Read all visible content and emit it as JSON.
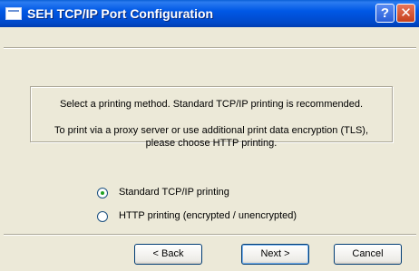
{
  "window": {
    "title": "SEH TCP/IP Port Configuration",
    "help_glyph": "?",
    "close_glyph": "✕"
  },
  "info": {
    "line1": "Select a printing method. Standard TCP/IP printing is recommended.",
    "line2": "To print via a proxy server or use additional print data encryption (TLS),",
    "line3": "please choose HTTP printing."
  },
  "options": [
    {
      "label": "Standard TCP/IP printing",
      "selected": true
    },
    {
      "label": "HTTP printing (encrypted / unencrypted)",
      "selected": false
    }
  ],
  "buttons": {
    "back": "< Back",
    "next": "Next >",
    "cancel": "Cancel"
  },
  "colors": {
    "titlebar": "#0058e6",
    "dialog_bg": "#ece9d8",
    "radio_dot": "#21a121"
  }
}
